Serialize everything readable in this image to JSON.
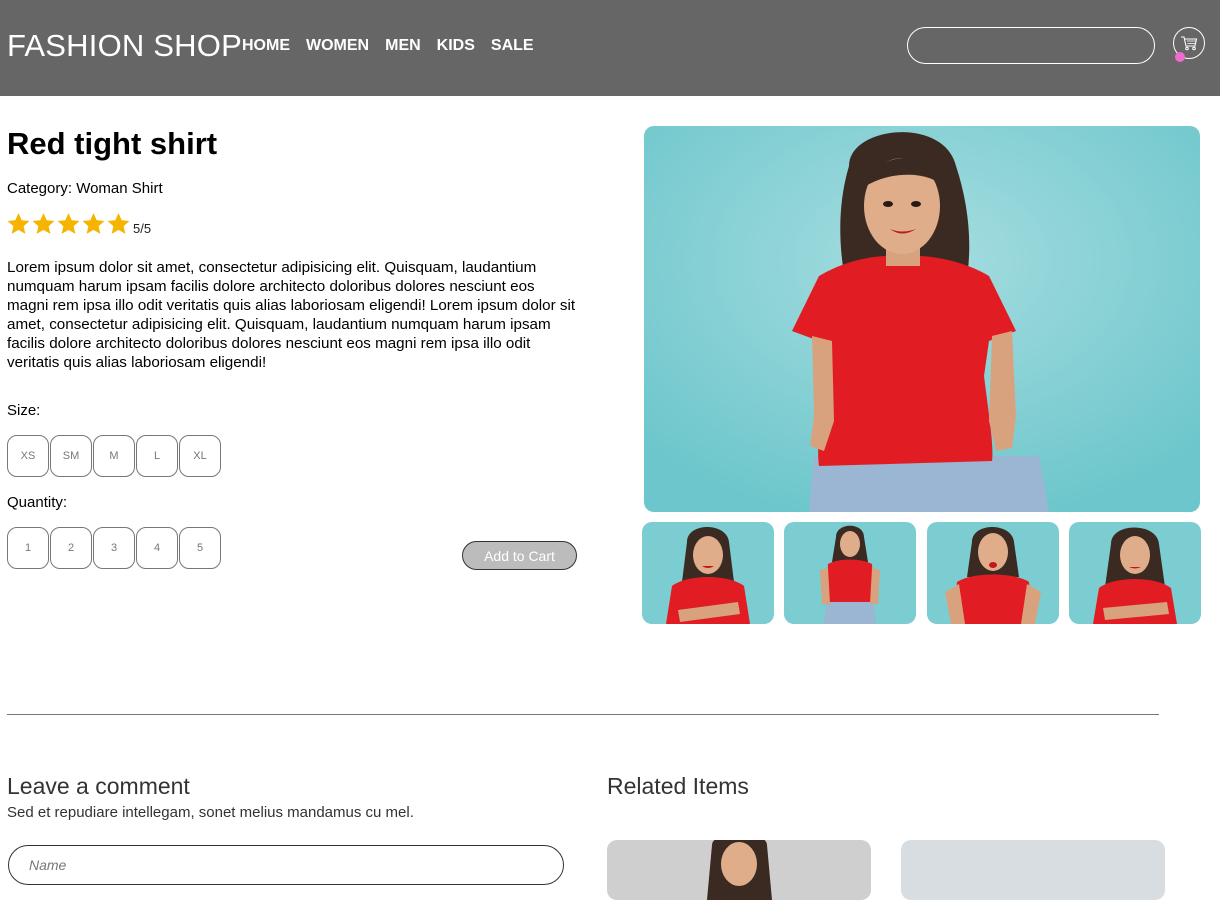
{
  "header": {
    "brand": "FASHION SHOP",
    "nav": [
      "HOME",
      "WOMEN",
      "MEN",
      "KIDS",
      "SALE"
    ],
    "search_placeholder": "",
    "cart_icon": "cart-icon",
    "cart_dot_color": "#f06bd0"
  },
  "product": {
    "title": "Red tight shirt",
    "category": "Category: Woman Shirt",
    "rating": 5,
    "rating_max": 5,
    "rating_text": "5/5",
    "star_color": "#f5b400",
    "description": "Lorem ipsum dolor sit amet, consectetur adipisicing elit. Quisquam, laudantium numquam harum ipsam facilis dolore architecto doloribus dolores nesciunt eos magni rem ipsa illo odit veritatis quis alias laboriosam eligendi! Lorem ipsum dolor sit amet, consectetur adipisicing elit. Quisquam, laudantium numquam harum ipsam facilis dolore architecto doloribus dolores nesciunt eos magni rem ipsa illo odit veritatis quis alias laboriosam eligendi!",
    "size_label": "Size:",
    "sizes": [
      "XS",
      "SM",
      "M",
      "L",
      "XL"
    ],
    "quantity_label": "Quantity:",
    "quantities": [
      "1",
      "2",
      "3",
      "4",
      "5"
    ],
    "add_to_cart": "Add to Cart"
  },
  "comment": {
    "heading": "Leave a comment",
    "subtext": "Sed et repudiare intellegam, sonet melius mandamus cu mel.",
    "name_placeholder": "Name"
  },
  "related": {
    "heading": "Related Items"
  }
}
